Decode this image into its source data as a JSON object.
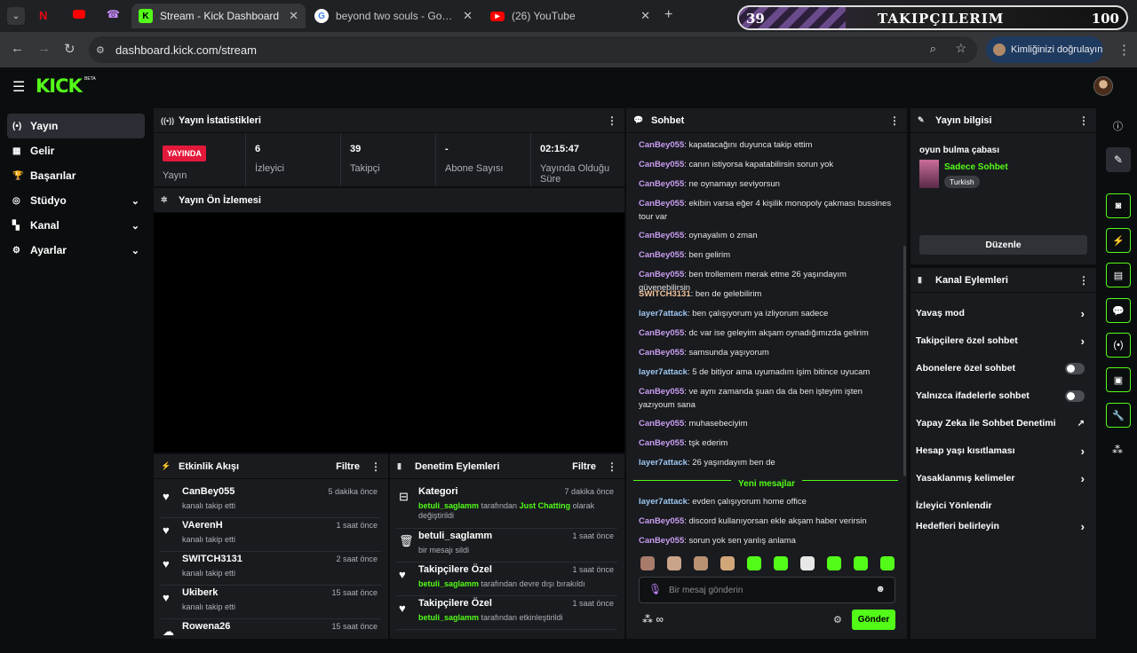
{
  "browser": {
    "tabs": [
      {
        "title": "Stream - Kick Dashboard"
      },
      {
        "title": "beyond two souls - Google'da Ara"
      },
      {
        "title": "(26) YouTube"
      }
    ],
    "url": "dashboard.kick.com/stream",
    "verify_label": "Kimliğinizi doğrulayın",
    "overlay": {
      "left_num": "39",
      "title": "TAKIPÇILERIM",
      "right_num": "100"
    }
  },
  "kick": {
    "logo": "KICK",
    "beta": "BETA"
  },
  "sidebar": {
    "items": [
      {
        "label": "Yayın",
        "icon": "broadcast-icon"
      },
      {
        "label": "Gelir",
        "icon": "revenue-icon"
      },
      {
        "label": "Başarılar",
        "icon": "trophy-icon"
      },
      {
        "label": "Stüdyo",
        "icon": "studio-icon"
      },
      {
        "label": "Kanal",
        "icon": "channel-icon"
      },
      {
        "label": "Ayarlar",
        "icon": "gear-icon"
      }
    ]
  },
  "stats": {
    "title": "Yayın İstatistikleri",
    "live_badge": "YAYINDA",
    "live_label": "Yayın",
    "viewers": {
      "value": "6",
      "label": "İzleyici"
    },
    "followers": {
      "value": "39",
      "label": "Takipçi"
    },
    "subs": {
      "value": "-",
      "label": "Abone Sayısı"
    },
    "uptime": {
      "value": "02:15:47",
      "label": "Yayında Olduğu Süre"
    }
  },
  "preview": {
    "title": "Yayın Ön İzlemesi"
  },
  "activity": {
    "title": "Etkinlik Akışı",
    "filter": "Filtre",
    "items": [
      {
        "name": "CanBey055",
        "desc": "kanalı takip etti",
        "time": "5 dakika önce"
      },
      {
        "name": "VAerenH",
        "desc": "kanalı takip etti",
        "time": "1 saat önce"
      },
      {
        "name": "SWITCH3131",
        "desc": "kanalı takip etti",
        "time": "2 saat önce"
      },
      {
        "name": "Ukiberk",
        "desc": "kanalı takip etti",
        "time": "15 saat önce"
      },
      {
        "name": "Rowena26",
        "desc": "",
        "time": "15 saat önce"
      }
    ]
  },
  "moderation": {
    "title": "Denetim Eylemleri",
    "filter": "Filtre",
    "items": [
      {
        "title": "Kategori",
        "user": "betuli_saglamm",
        "desc1": " tarafından ",
        "highlight": "Just Chatting",
        "desc2": " olarak değiştirildi",
        "time": "7 dakika önce"
      },
      {
        "title": "betuli_saglamm",
        "user": "",
        "desc1": "bir mesajı sildi",
        "highlight": "",
        "desc2": "",
        "time": "1 saat önce"
      },
      {
        "title": "Takipçilere Özel",
        "user": "betuli_saglamm",
        "desc1": " tarafından devre dışı bırakıldı",
        "highlight": "",
        "desc2": "",
        "time": "1 saat önce"
      },
      {
        "title": "Takipçilere Özel",
        "user": "betuli_saglamm",
        "desc1": " tarafından etkinleştirildi",
        "highlight": "",
        "desc2": "",
        "time": "1 saat önce"
      }
    ]
  },
  "chat": {
    "title": "Sohbet",
    "messages": [
      {
        "user": "CanBey055",
        "text": "kapatacağını duyunca takip ettim"
      },
      {
        "user": "CanBey055",
        "text": "canın istiyorsa kapatabilirsin sorun yok"
      },
      {
        "user": "CanBey055",
        "text": "ne oynamayı seviyorsun"
      },
      {
        "user": "CanBey055",
        "text": "ekibin varsa eğer 4 kişilik monopoly çakması bussines tour var"
      },
      {
        "user": "CanBey055",
        "text": "oynayalım o zman"
      },
      {
        "user": "CanBey055",
        "text": "ben gelirim"
      },
      {
        "user": "CanBey055",
        "text": "ben trollemem merak etme 26 yaşındayım güvenebilirsin"
      },
      {
        "user": "SWITCH3131",
        "text": "ben de gelebilirim"
      },
      {
        "user": "layer7attack",
        "text": "ben çalışıyorum ya izliyorum sadece"
      },
      {
        "user": "CanBey055",
        "text": "dc var ise geleyim akşam oynadığımızda gelirim"
      },
      {
        "user": "CanBey055",
        "text": "samsunda yaşıyorum"
      },
      {
        "user": "layer7attack",
        "text": "5 de bitiyor ama uyumadım işim bitince uyucam"
      },
      {
        "user": "CanBey055",
        "text": "ve aynı zamanda şuan da da ben işteyim işten yazıyoum sana"
      },
      {
        "user": "CanBey055",
        "text": "muhasebeciyim"
      },
      {
        "user": "CanBey055",
        "text": "tşk ederim"
      },
      {
        "user": "layer7attack",
        "text": "26 yaşındayım ben de"
      }
    ],
    "new_label": "Yeni mesajlar",
    "new_messages": [
      {
        "user": "layer7attack",
        "text": "evden çalışıyorum home office"
      },
      {
        "user": "CanBey055",
        "text": "discord kullanıyorsan ekle akşam haber verirsin"
      },
      {
        "user": "CanBey055",
        "text": "sorun yok sen yanlış anlama"
      }
    ],
    "placeholder": "Bir mesaj gönderin",
    "send": "Gönder"
  },
  "streaminfo": {
    "title": "Yayın bilgisi",
    "stream_title": "oyun bulma çabası",
    "category": "Sadece Sohbet",
    "tag": "Turkish",
    "edit": "Düzenle"
  },
  "channel_actions": {
    "title": "Kanal Eylemleri",
    "items": [
      {
        "label": "Yavaş mod",
        "type": "chevron"
      },
      {
        "label": "Takipçilere özel sohbet",
        "type": "chevron"
      },
      {
        "label": "Abonelere özel sohbet",
        "type": "toggle"
      },
      {
        "label": "Yalnızca ifadelerle sohbet",
        "type": "toggle"
      },
      {
        "label": "Yapay Zeka ile Sohbet Denetimi",
        "type": "external"
      },
      {
        "label": "Hesap yaşı kısıtlaması",
        "type": "chevron"
      },
      {
        "label": "Yasaklanmış kelimeler",
        "type": "chevron"
      },
      {
        "label": "İzleyici Yönlendir",
        "type": "none"
      },
      {
        "label": "Hedefleri belirleyin",
        "type": "chevron"
      }
    ]
  },
  "colors": {
    "accent": "#53fc18",
    "live": "#e3193b",
    "panel": "#191b1f",
    "bg": "#0b0e0f"
  }
}
